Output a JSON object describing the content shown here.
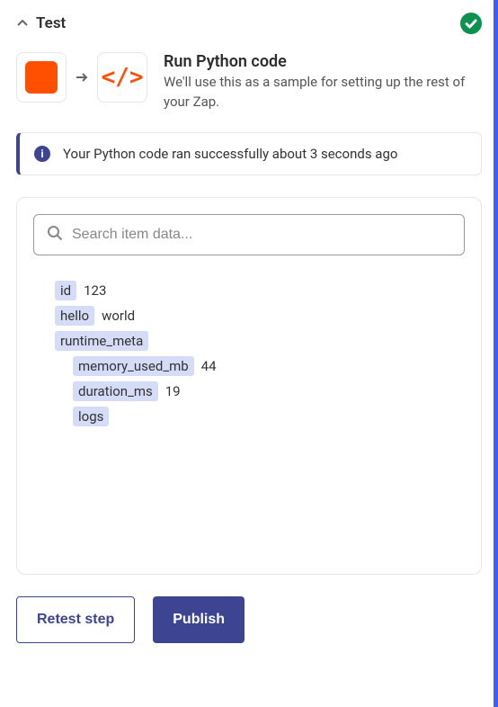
{
  "header": {
    "title": "Test"
  },
  "intro": {
    "title": "Run Python code",
    "subtitle": "We'll use this as a sample for setting up the rest of your Zap."
  },
  "notice": {
    "text": "Your Python code ran successfully about 3 seconds ago"
  },
  "search": {
    "placeholder": "Search item data..."
  },
  "result": {
    "id_key": "id",
    "id_value": "123",
    "hello_key": "hello",
    "hello_value": "world",
    "runtime_meta_key": "runtime_meta",
    "memory_key": "memory_used_mb",
    "memory_value": "44",
    "duration_key": "duration_ms",
    "duration_value": "19",
    "logs_key": "logs"
  },
  "buttons": {
    "retest": "Retest step",
    "publish": "Publish"
  }
}
